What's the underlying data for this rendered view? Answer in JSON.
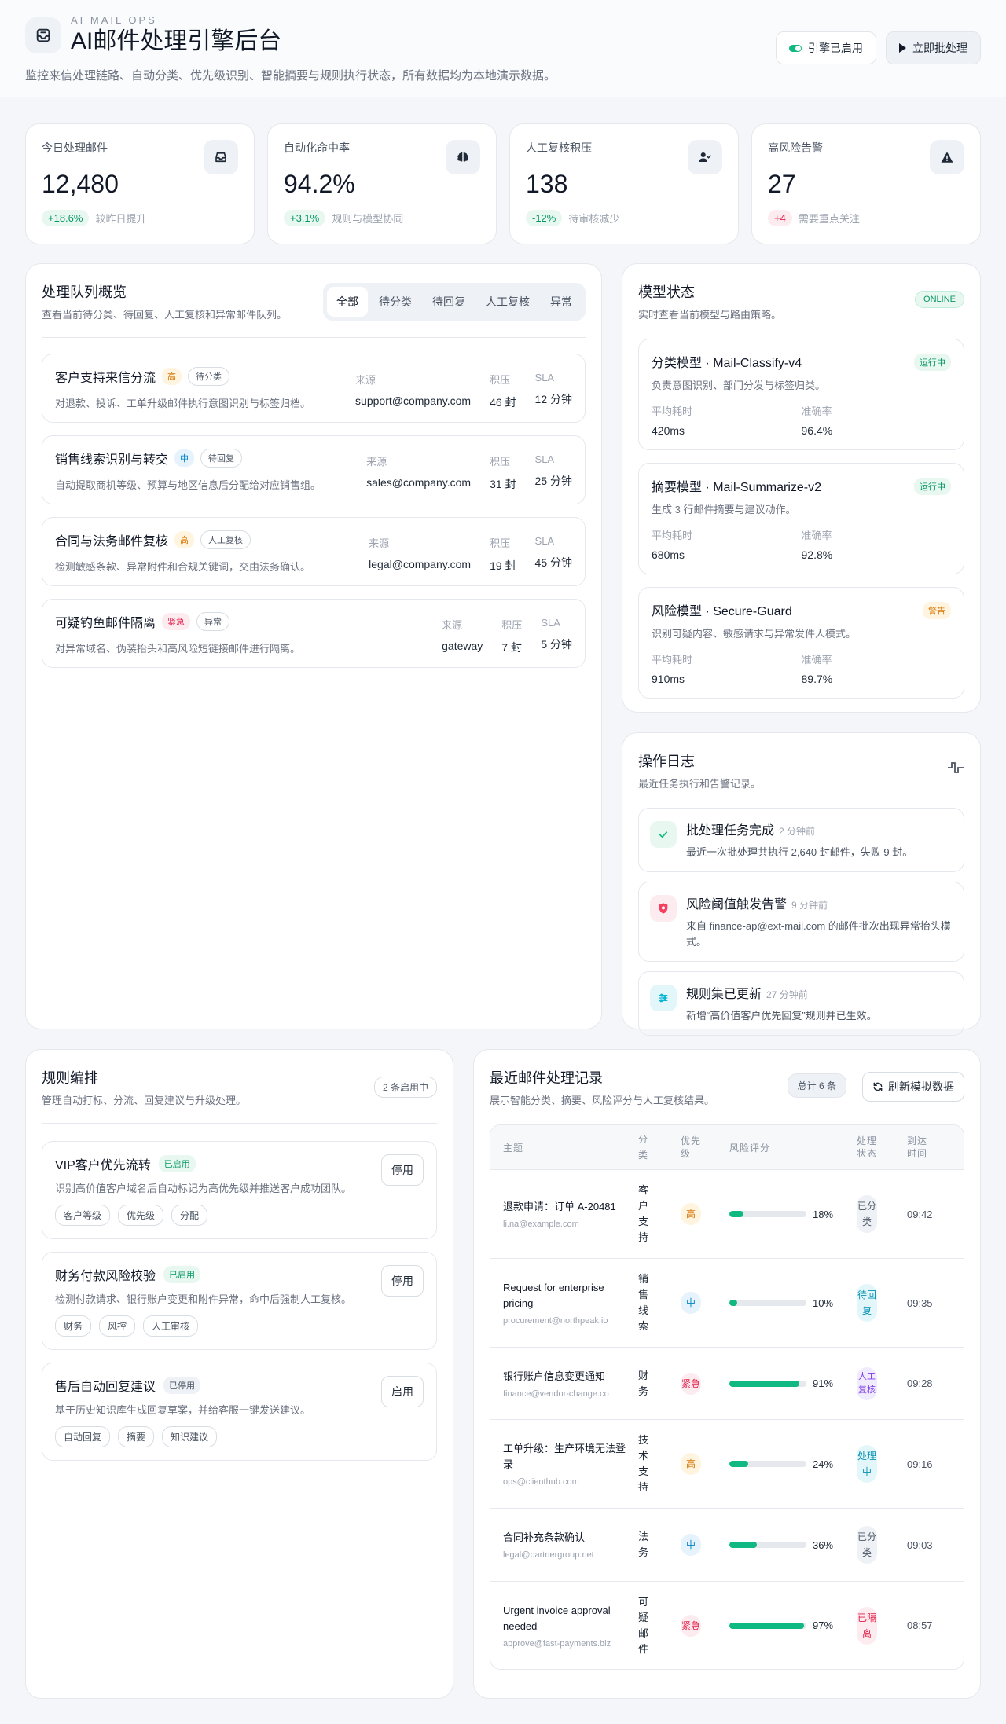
{
  "header": {
    "kicker": "AI MAIL OPS",
    "title": "AI邮件处理引擎后台",
    "description": "监控来信处理链路、自动分类、优先级识别、智能摘要与规则执行状态，所有数据均为本地演示数据。",
    "engine_label": "引擎已启用",
    "process_label": "立即批处理"
  },
  "stats": [
    {
      "label": "今日处理邮件",
      "value": "12,480",
      "delta": "+18.6%",
      "note": "较昨日提升",
      "icon": "inbox-icon"
    },
    {
      "label": "自动化命中率",
      "value": "94.2%",
      "delta": "+3.1%",
      "note": "规则与模型协同",
      "icon": "brain-icon"
    },
    {
      "label": "人工复核积压",
      "value": "138",
      "delta": "-12%",
      "note": "待审核减少",
      "icon": "user-check-icon"
    },
    {
      "label": "高风险告警",
      "value": "27",
      "delta": "+4",
      "note": "需要重点关注",
      "icon": "warning-icon"
    }
  ],
  "queue": {
    "title": "处理队列概览",
    "subtitle": "查看当前待分类、待回复、人工复核和异常邮件队列。",
    "tabs": [
      "全部",
      "待分类",
      "待回复",
      "人工复核",
      "异常"
    ],
    "active_tab": "全部",
    "meta_labels": {
      "source": "来源",
      "backlog": "积压",
      "sla": "SLA"
    },
    "items": [
      {
        "name": "客户支持来信分流",
        "priority": "高",
        "status": "待分类",
        "desc": "对退款、投诉、工单升级邮件执行意图识别与标签归档。",
        "source": "support@company.com",
        "backlog": "46 封",
        "sla": "12 分钟"
      },
      {
        "name": "销售线索识别与转交",
        "priority": "中",
        "status": "待回复",
        "desc": "自动提取商机等级、预算与地区信息后分配给对应销售组。",
        "source": "sales@company.com",
        "backlog": "31 封",
        "sla": "25 分钟"
      },
      {
        "name": "合同与法务邮件复核",
        "priority": "高",
        "status": "人工复核",
        "desc": "检测敏感条款、异常附件和合规关键词，交由法务确认。",
        "source": "legal@company.com",
        "backlog": "19 封",
        "sla": "45 分钟"
      },
      {
        "name": "可疑钓鱼邮件隔离",
        "priority": "紧急",
        "status": "异常",
        "desc": "对异常域名、伪装抬头和高风险短链接邮件进行隔离。",
        "source": "gateway",
        "backlog": "7 封",
        "sla": "5 分钟"
      }
    ]
  },
  "models": {
    "title": "模型状态",
    "subtitle": "实时查看当前模型与路由策略。",
    "badge": "ONLINE",
    "latency_label": "平均耗时",
    "accuracy_label": "准确率",
    "items": [
      {
        "name": "分类模型 · Mail-Classify-v4",
        "desc": "负责意图识别、部门分发与标签归类。",
        "status": "运行中",
        "latency": "420ms",
        "accuracy": "96.4%"
      },
      {
        "name": "摘要模型 · Mail-Summarize-v2",
        "desc": "生成 3 行邮件摘要与建议动作。",
        "status": "运行中",
        "latency": "680ms",
        "accuracy": "92.8%"
      },
      {
        "name": "风险模型 · Secure-Guard",
        "desc": "识别可疑内容、敏感请求与异常发件人模式。",
        "status": "警告",
        "latency": "910ms",
        "accuracy": "89.7%"
      }
    ]
  },
  "logs": {
    "title": "操作日志",
    "subtitle": "最近任务执行和告警记录。",
    "items": [
      {
        "title": "批处理任务完成",
        "time": "2 分钟前",
        "text": "最近一次批处理共执行 2,640 封邮件，失败 9 封。"
      },
      {
        "title": "风险阈值触发告警",
        "time": "9 分钟前",
        "text": "来自 finance-ap@ext-mail.com 的邮件批次出现异常抬头模式。"
      },
      {
        "title": "规则集已更新",
        "time": "27 分钟前",
        "text": "新增“高价值客户优先回复”规则并已生效。"
      }
    ]
  },
  "rules": {
    "title": "规则编排",
    "subtitle": "管理自动打标、分流、回复建议与升级处理。",
    "count": "2 条启用中",
    "items": [
      {
        "name": "VIP客户优先流转",
        "state": "已启用",
        "desc": "识别高价值客户域名后自动标记为高优先级并推送客户成功团队。",
        "tags": [
          "客户等级",
          "优先级",
          "分配"
        ],
        "action": "停用"
      },
      {
        "name": "财务付款风险校验",
        "state": "已启用",
        "desc": "检测付款请求、银行账户变更和附件异常，命中后强制人工复核。",
        "tags": [
          "财务",
          "风控",
          "人工审核"
        ],
        "action": "停用"
      },
      {
        "name": "售后自动回复建议",
        "state": "已停用",
        "desc": "基于历史知识库生成回复草案，并给客服一键发送建议。",
        "tags": [
          "自动回复",
          "摘要",
          "知识建议"
        ],
        "action": "启用"
      }
    ]
  },
  "recent": {
    "title": "最近邮件处理记录",
    "subtitle": "展示智能分类、摘要、风险评分与人工复核结果。",
    "total": "总计 6 条",
    "refresh_label": "刷新模拟数据",
    "columns": [
      "主题",
      "分类",
      "优先级",
      "风险评分",
      "处理状态",
      "到达时间"
    ],
    "rows": [
      {
        "subject": "退款申请：订单 A-20481",
        "sender": "li.na@example.com",
        "category": "客户支持",
        "priority": "高",
        "risk": 18,
        "risk_label": "18%",
        "status": "已分类",
        "time": "09:42"
      },
      {
        "subject": "Request for enterprise pricing",
        "sender": "procurement@northpeak.io",
        "category": "销售线索",
        "priority": "中",
        "risk": 10,
        "risk_label": "10%",
        "status": "待回复",
        "time": "09:35"
      },
      {
        "subject": "银行账户信息变更通知",
        "sender": "finance@vendor-change.co",
        "category": "财务",
        "priority": "紧急",
        "risk": 91,
        "risk_label": "91%",
        "status": "人工复核",
        "time": "09:28"
      },
      {
        "subject": "工单升级：生产环境无法登录",
        "sender": "ops@clienthub.com",
        "category": "技术支持",
        "priority": "高",
        "risk": 24,
        "risk_label": "24%",
        "status": "处理中",
        "time": "09:16"
      },
      {
        "subject": "合同补充条款确认",
        "sender": "legal@partnergroup.net",
        "category": "法务",
        "priority": "中",
        "risk": 36,
        "risk_label": "36%",
        "status": "已分类",
        "time": "09:03"
      },
      {
        "subject": "Urgent invoice approval needed",
        "sender": "approve@fast-payments.biz",
        "category": "可疑邮件",
        "priority": "紧急",
        "risk": 97,
        "risk_label": "97%",
        "status": "已隔离",
        "time": "08:57"
      }
    ]
  }
}
